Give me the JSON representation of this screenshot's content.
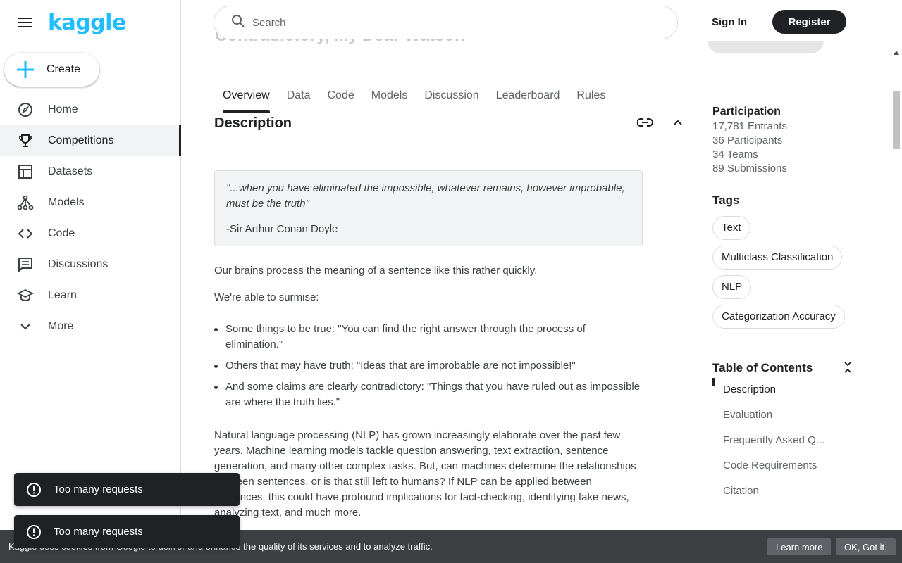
{
  "brand": {
    "logo_text": "kaggle",
    "color": "#20beff"
  },
  "sidebar": {
    "create_label": "Create",
    "items": [
      {
        "label": "Home",
        "icon": "compass-icon"
      },
      {
        "label": "Competitions",
        "icon": "trophy-icon",
        "active": true
      },
      {
        "label": "Datasets",
        "icon": "table-icon"
      },
      {
        "label": "Models",
        "icon": "models-icon"
      },
      {
        "label": "Code",
        "icon": "code-icon"
      },
      {
        "label": "Discussions",
        "icon": "comment-icon"
      },
      {
        "label": "Learn",
        "icon": "school-icon"
      },
      {
        "label": "More",
        "icon": "chevron-down-icon"
      }
    ]
  },
  "header": {
    "search_placeholder": "Search",
    "sign_in": "Sign In",
    "register": "Register"
  },
  "competition": {
    "title_partial": "Contradictory, My Dear Watson"
  },
  "tabs": [
    "Overview",
    "Data",
    "Code",
    "Models",
    "Discussion",
    "Leaderboard",
    "Rules"
  ],
  "description": {
    "heading": "Description",
    "quote": "\"...when you have eliminated the impossible, whatever remains, however improbable, must be the truth\"",
    "quote_author": "-Sir Arthur Conan Doyle",
    "p1": "Our brains process the meaning of a sentence like this rather quickly.",
    "p2": "We're able to surmise:",
    "bullets": [
      "Some things to be true: \"You can find the right answer through the process of elimination.”",
      "Others that may have truth: \"Ideas that are improbable are not impossible!\"",
      "And some claims are clearly contradictory: \"Things that you have ruled out as impossible are where the truth lies.\""
    ],
    "p3": "Natural language processing (NLP) has grown increasingly elaborate over the past few years. Machine learning models tackle question answering, text extraction, sentence generation, and many other complex tasks. But, can machines determine the relationships between sentences, or is that still left to humans? If NLP can be applied between sentences, this could have profound implications for fact-checking, identifying fake news, analyzing text, and much more."
  },
  "participation": {
    "title": "Participation",
    "entrants": "17,781 Entrants",
    "participants": "36 Participants",
    "teams": "34 Teams",
    "submissions": "89 Submissions"
  },
  "tags": {
    "title": "Tags",
    "items": [
      "Text",
      "Multiclass Classification",
      "NLP",
      "Categorization Accuracy"
    ]
  },
  "toc": {
    "title": "Table of Contents",
    "items": [
      "Description",
      "Evaluation",
      "Frequently Asked Q...",
      "Code Requirements",
      "Citation"
    ]
  },
  "toasts": [
    "Too many requests",
    "Too many requests"
  ],
  "cookie": {
    "text": "Kaggle uses cookies from Google to deliver and enhance the quality of its services and to analyze traffic.",
    "learn_more": "Learn more",
    "ok": "OK, Got it."
  }
}
